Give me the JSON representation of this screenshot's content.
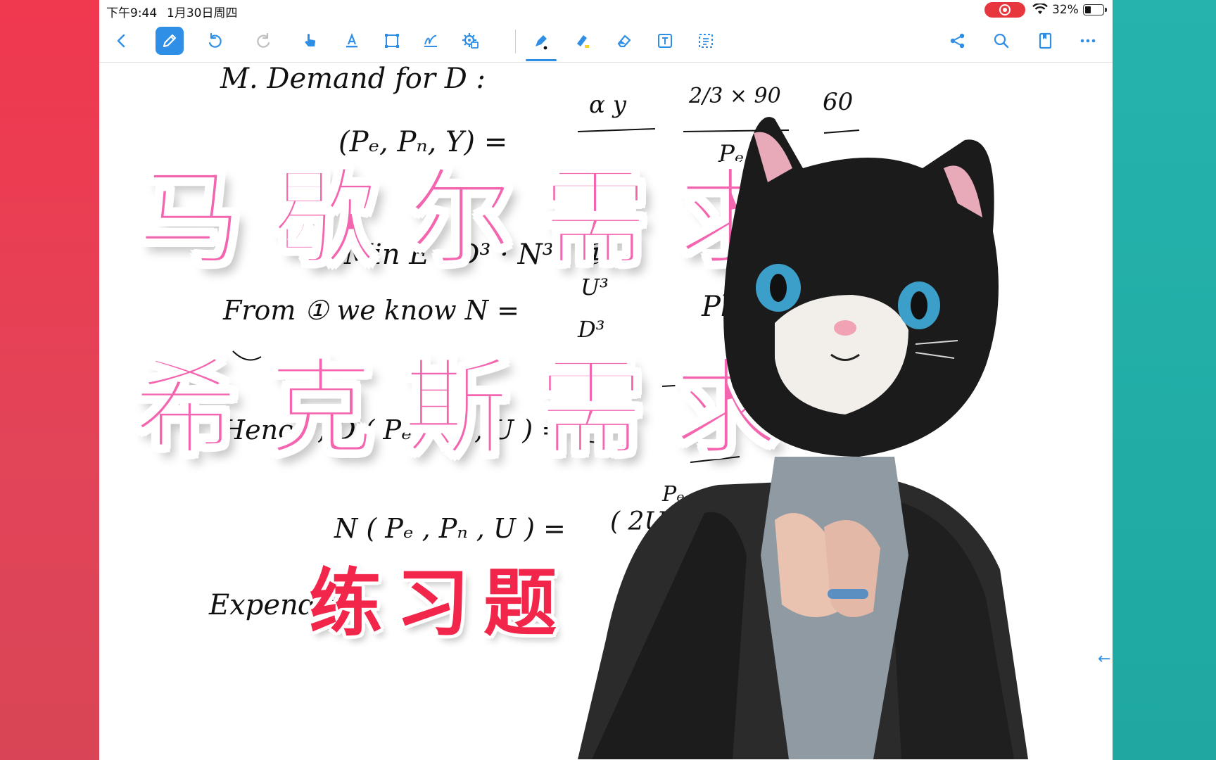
{
  "status_bar": {
    "time": "下午9:44",
    "date": "1月30日周四",
    "battery_percent": "32%",
    "battery_level": 0.32
  },
  "toolbar": {
    "left_tools": [
      "back-icon",
      "pencil-icon",
      "undo-icon",
      "redo-icon",
      "hand-icon",
      "text-underline-icon",
      "shape-icon",
      "signature-icon",
      "settings-icon"
    ],
    "right_tools": [
      "share-nodes-icon",
      "search-icon",
      "bookmark-icon",
      "more-icon"
    ],
    "active_tool": "pencil-icon",
    "accent_color": "#2f8fe6"
  },
  "notes": {
    "line1": "M. Demand for D :",
    "frac_top_num": "α y",
    "frac_top_num2": "2/3 × 90",
    "frac_top_result": "60",
    "eq1": "(Pₑ, Pₙ, Y) =",
    "denom1": "Pₑ",
    "line_min": "Min E :  D³ · N³ · ①",
    "line_from": "From ①  we know  N =",
    "frac_u": "U³",
    "frac_d": "D³",
    "plug": "Plug",
    "line_hence": "Hence ,  D ( Pₑ , Pₙ , U ) =",
    "line_n": "N ( Pₑ , Pₙ , U ) =",
    "n_rhs": "( 2U · P",
    "pd": "Pₑ",
    "line_exp": "Expendit"
  },
  "overlay": {
    "title_line1": "马歇尔需求",
    "title_line2": "希克斯需求",
    "subtitle": "练习题",
    "title_color": "#f465b0",
    "subtitle_color": "#f2264a"
  },
  "colors": {
    "left_band": "#f0384f",
    "right_band": "#26b3ad"
  }
}
